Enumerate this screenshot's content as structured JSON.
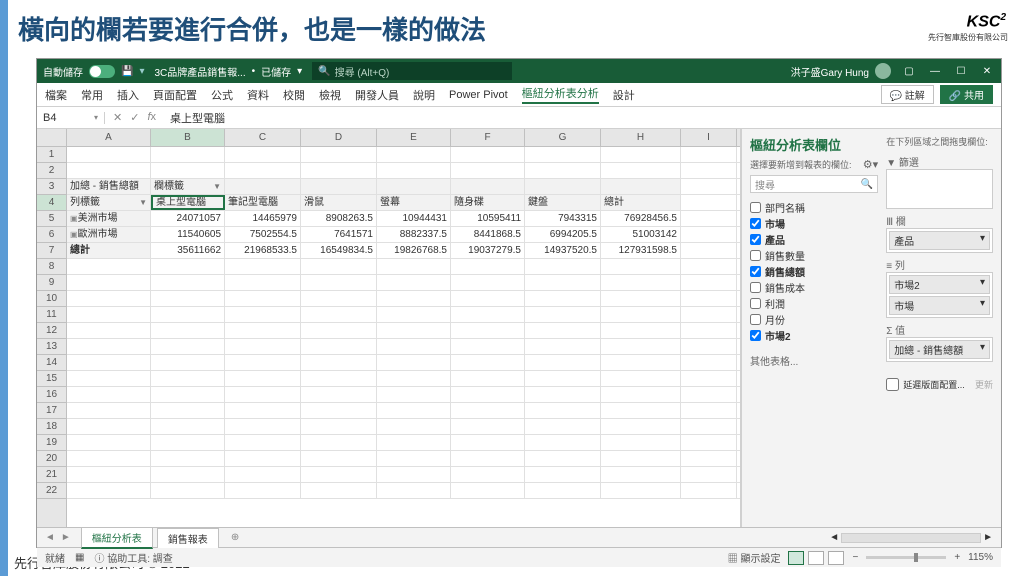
{
  "slide": {
    "title": "橫向的欄若要進行合併，也是一樣的做法",
    "footer": "先行智庫股份有限公司 © 2022",
    "logo": "KSC",
    "logo_sub": "先行智庫股份有限公司"
  },
  "titlebar": {
    "autosave": "自動儲存",
    "file": "3C品牌產品銷售報...",
    "saved": "已儲存",
    "search_ph": "搜尋 (Alt+Q)",
    "user": "洪子盛Gary Hung"
  },
  "ribbon": {
    "tabs": [
      "檔案",
      "常用",
      "插入",
      "頁面配置",
      "公式",
      "資料",
      "校閱",
      "檢視",
      "開發人員",
      "說明",
      "Power Pivot",
      "樞紐分析表分析",
      "設計"
    ],
    "active": "樞紐分析表分析",
    "comments": "註解",
    "share": "共用"
  },
  "formula": {
    "name_box": "B4",
    "value": "桌上型電腦"
  },
  "columns": [
    "A",
    "B",
    "C",
    "D",
    "E",
    "F",
    "G",
    "H",
    "I"
  ],
  "pivot": {
    "r3a": "加總 - 銷售總額",
    "r3b": "欄標籤",
    "r4a": "列標籤",
    "r4": [
      "桌上型電腦",
      "筆記型電腦",
      "滑鼠",
      "螢幕",
      "隨身碟",
      "鍵盤",
      "總計"
    ],
    "r5a": "美洲市場",
    "r5": [
      "24071057",
      "14465979",
      "8908263.5",
      "10944431",
      "10595411",
      "7943315",
      "76928456.5"
    ],
    "r6a": "歐洲市場",
    "r6": [
      "11540605",
      "7502554.5",
      "7641571",
      "8882337.5",
      "8441868.5",
      "6994205.5",
      "51003142"
    ],
    "r7a": "總計",
    "r7": [
      "35611662",
      "21968533.5",
      "16549834.5",
      "19826768.5",
      "19037279.5",
      "14937520.5",
      "127931598.5"
    ]
  },
  "pane": {
    "title": "樞紐分析表欄位",
    "sub": "選擇要新增到報表的欄位:",
    "search": "搜尋",
    "drag_hint": "在下列區域之間拖曳欄位:",
    "fields": [
      {
        "label": "部門名稱",
        "checked": false,
        "bold": false
      },
      {
        "label": "市場",
        "checked": true,
        "bold": true
      },
      {
        "label": "產品",
        "checked": true,
        "bold": true
      },
      {
        "label": "銷售數量",
        "checked": false,
        "bold": false
      },
      {
        "label": "銷售總額",
        "checked": true,
        "bold": true
      },
      {
        "label": "銷售成本",
        "checked": false,
        "bold": false
      },
      {
        "label": "利潤",
        "checked": false,
        "bold": false
      },
      {
        "label": "月份",
        "checked": false,
        "bold": false
      },
      {
        "label": "市場2",
        "checked": true,
        "bold": true
      }
    ],
    "other_tables": "其他表格...",
    "areas": {
      "filter": "篩選",
      "columns": "欄",
      "col_item": "產品",
      "rows": "列",
      "row_items": [
        "市場2",
        "市場"
      ],
      "values": "值",
      "val_item": "加總 - 銷售總額"
    },
    "defer": "延遲版面配置...",
    "update": "更新"
  },
  "sheets": {
    "active": "樞紐分析表",
    "other": "銷售報表"
  },
  "status": {
    "ready": "就緒",
    "acc": "協助工具: 調查",
    "display": "顯示設定",
    "zoom": "115%"
  },
  "chart_data": {
    "type": "table",
    "title": "加總 - 銷售總額",
    "columns": [
      "桌上型電腦",
      "筆記型電腦",
      "滑鼠",
      "螢幕",
      "隨身碟",
      "鍵盤",
      "總計"
    ],
    "rows": [
      "美洲市場",
      "歐洲市場",
      "總計"
    ],
    "values": [
      [
        24071057,
        14465979,
        8908263.5,
        10944431,
        10595411,
        7943315,
        76928456.5
      ],
      [
        11540605,
        7502554.5,
        7641571,
        8882337.5,
        8441868.5,
        6994205.5,
        51003142
      ],
      [
        35611662,
        21968533.5,
        16549834.5,
        19826768.5,
        19037279.5,
        14937520.5,
        127931598.5
      ]
    ]
  }
}
